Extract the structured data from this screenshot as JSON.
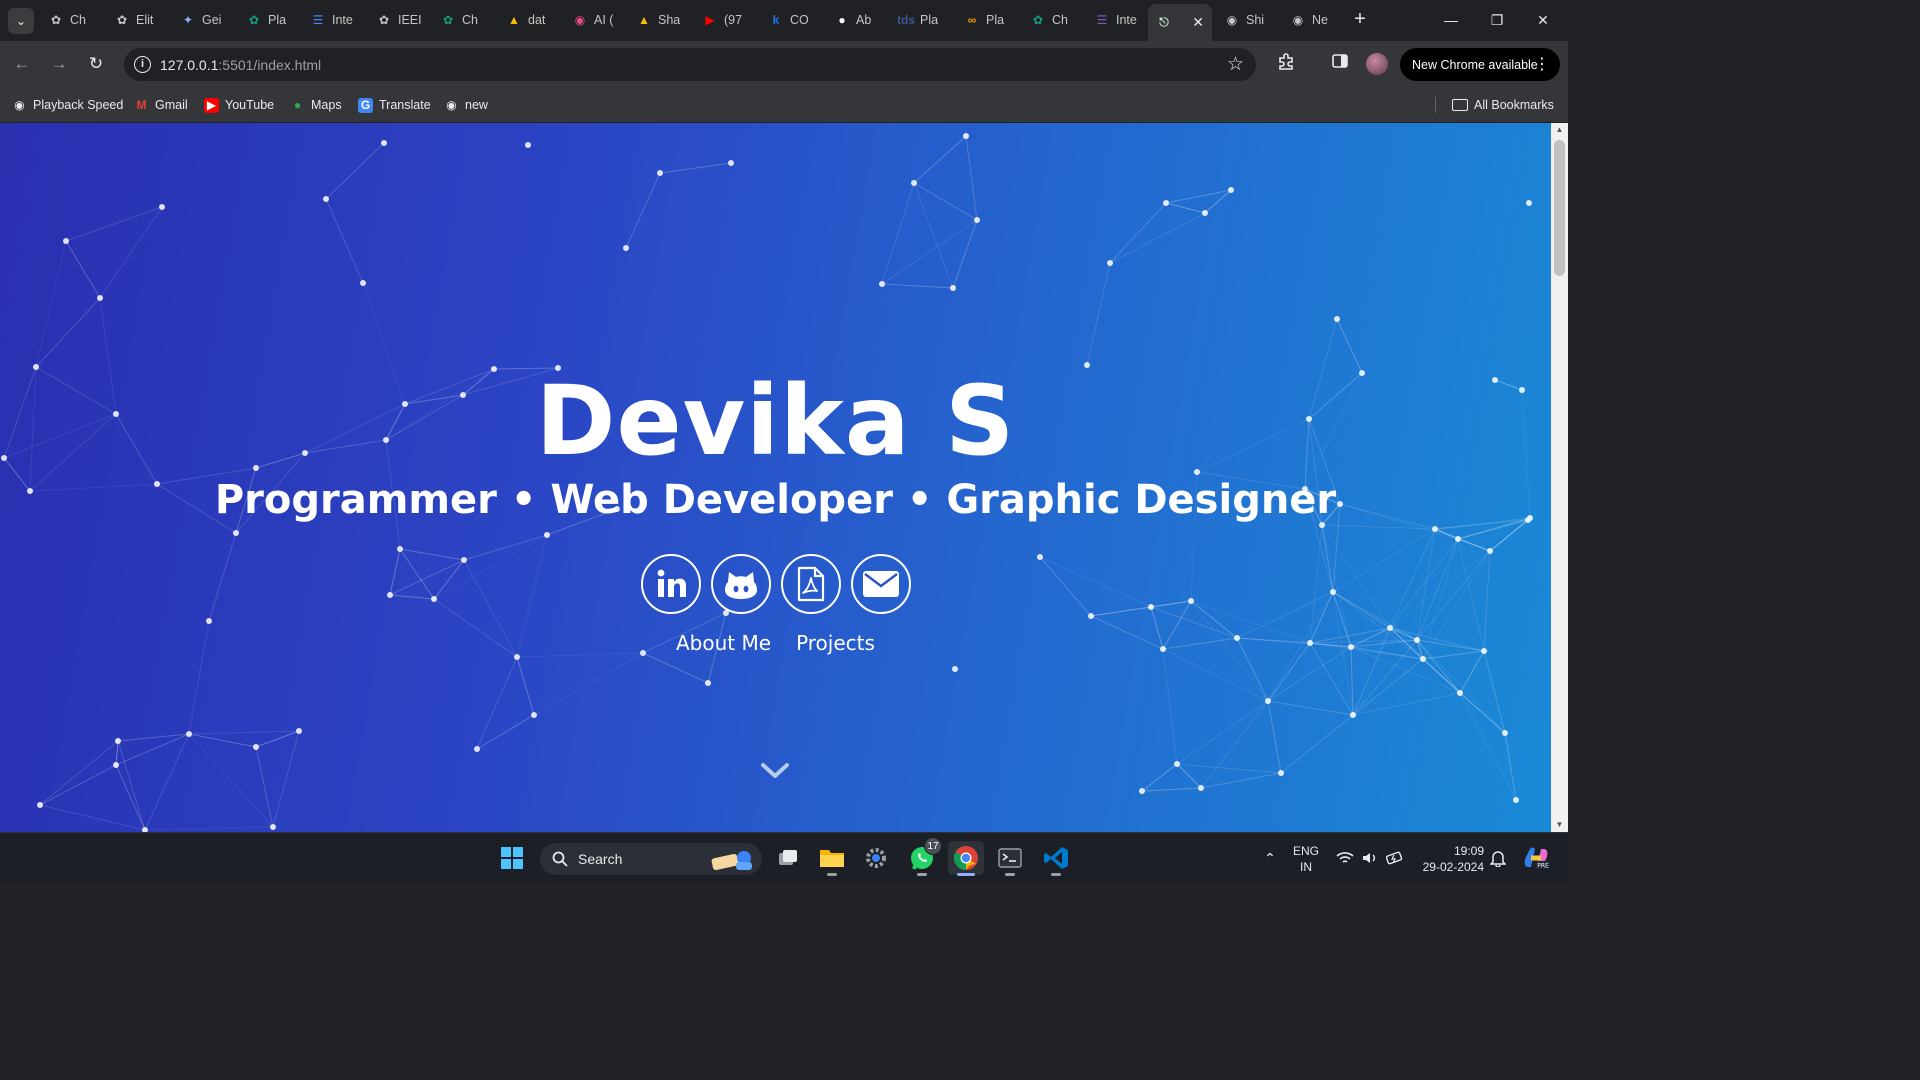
{
  "browser": {
    "tabs": [
      {
        "label": "Ch",
        "favicon": "chatgpt-icon",
        "color": "#c4c7c5"
      },
      {
        "label": "Elit",
        "favicon": "openai-icon",
        "color": "#c4c7c5"
      },
      {
        "label": "Gei",
        "favicon": "gemini-icon",
        "color": "#8ab4f8"
      },
      {
        "label": "Pla",
        "favicon": "chatgpt-icon",
        "color": "#10a37f"
      },
      {
        "label": "Inte",
        "favicon": "docs-icon",
        "color": "#4285f4"
      },
      {
        "label": "IEEI",
        "favicon": "openai-icon",
        "color": "#c4c7c5"
      },
      {
        "label": "Ch",
        "favicon": "chatgpt-icon",
        "color": "#10a37f"
      },
      {
        "label": "dat",
        "favicon": "drive-icon",
        "color": "#fbbc04"
      },
      {
        "label": "AI (",
        "favicon": "ai-icon",
        "color": "#ea4c89"
      },
      {
        "label": "Sha",
        "favicon": "drive-icon",
        "color": "#fbbc04"
      },
      {
        "label": "(97",
        "favicon": "youtube-icon",
        "color": "#ff0000"
      },
      {
        "label": "CO",
        "favicon": "k-icon",
        "color": "#1a73e8"
      },
      {
        "label": "Ab",
        "favicon": "github-icon",
        "color": "#ffffff"
      },
      {
        "label": "Pla",
        "favicon": "tds-icon",
        "color": "#3c5a99"
      },
      {
        "label": "Pla",
        "favicon": "infinity-icon",
        "color": "#f29900"
      },
      {
        "label": "Ch",
        "favicon": "chatgpt-icon",
        "color": "#10a37f"
      },
      {
        "label": "Inte",
        "favicon": "forms-icon",
        "color": "#7e57c2"
      },
      {
        "label": "",
        "favicon": "headset-icon",
        "color": "#c8e6c9",
        "active": true
      },
      {
        "label": "Shi",
        "favicon": "globe-icon",
        "color": "#c4c7c5"
      },
      {
        "label": "Ne",
        "favicon": "globe-icon",
        "color": "#c4c7c5"
      }
    ],
    "url_host": "127.0.0.1",
    "url_rest": ":5501/index.html",
    "update_label": "New Chrome available",
    "bookmarks": [
      {
        "label": "Playback Speed",
        "icon": "globe-icon"
      },
      {
        "label": "Gmail",
        "icon": "gmail-icon"
      },
      {
        "label": "YouTube",
        "icon": "youtube-icon"
      },
      {
        "label": "Maps",
        "icon": "maps-icon"
      },
      {
        "label": "Translate",
        "icon": "translate-icon"
      },
      {
        "label": "new",
        "icon": "globe-icon"
      }
    ],
    "all_bookmarks_label": "All Bookmarks"
  },
  "hero": {
    "name": "Devika S",
    "roles": "Programmer • Web Developer • Graphic Designer",
    "links": [
      "About Me",
      "Projects"
    ],
    "socials": [
      "linkedin-icon",
      "github-icon",
      "pdf-resume-icon",
      "email-icon"
    ]
  },
  "taskbar": {
    "search_label": "Search",
    "whatsapp_badge": "17",
    "lang_line1": "ENG",
    "lang_line2": "IN",
    "time": "19:09",
    "date": "29-02-2024"
  },
  "colors": {
    "gradient_start": "#2a2fb0",
    "gradient_end": "#1a8ad6",
    "browser_dark": "#202124",
    "toolbar": "#35363a"
  }
}
